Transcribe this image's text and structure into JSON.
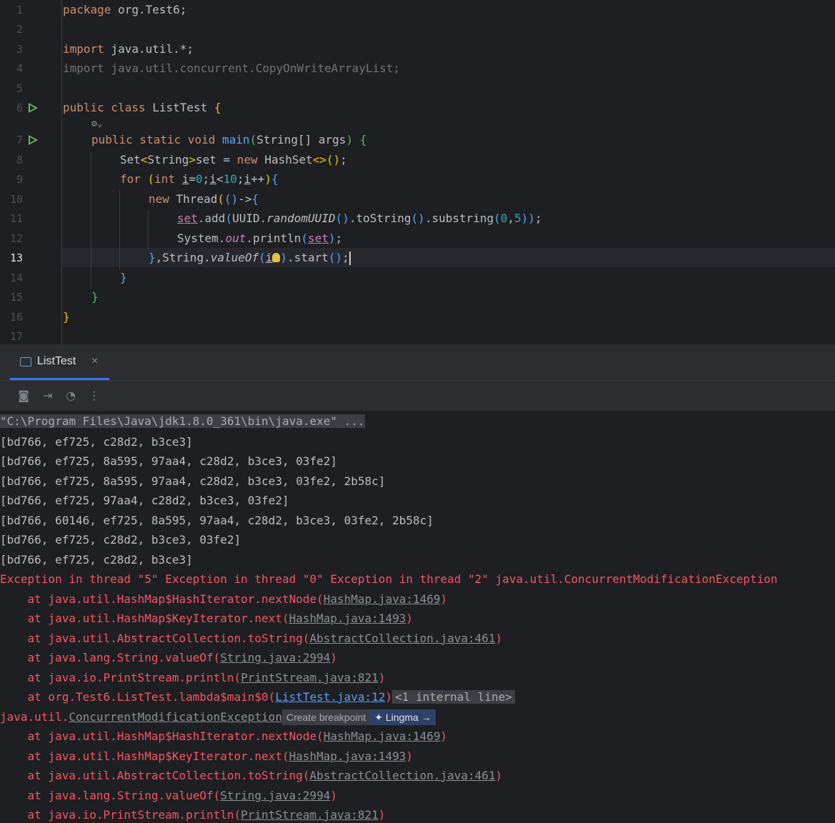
{
  "editor": {
    "line_numbers": [
      "1",
      "2",
      "3",
      "4",
      "5",
      "6",
      "7",
      "8",
      "9",
      "10",
      "11",
      "12",
      "13",
      "14",
      "15",
      "16",
      "17"
    ],
    "current_line": "13",
    "code": {
      "l1_kw": "package",
      "l1_rest": " org.Test6;",
      "l3_kw": "import",
      "l3_rest": " java.util.*;",
      "l4": "import java.util.concurrent.CopyOnWriteArrayList;",
      "l6_kw": "public class",
      "l6_name": " ListTest ",
      "l6_brace": "{",
      "l7_kw": "public static void",
      "l7_fn": " main",
      "l7_p1": "(",
      "l7_args": "String[] args",
      "l7_p2": ")",
      "l7_brace": " {",
      "l8_a": "Set",
      "l8_b": "<",
      "l8_c": "String",
      "l8_d": ">",
      "l8_e": "set = ",
      "l8_new": "new",
      "l8_f": " HashSet",
      "l8_g": "<>",
      "l8_h": "()",
      "l8_i": ";",
      "l9_kw": "for",
      "l9_p1": " (",
      "l9_int": "int",
      "l9_sp": " ",
      "l9_i1": "i",
      "l9_eq": "=",
      "l9_zero": "0",
      "l9_semi1": ";",
      "l9_i2": "i",
      "l9_lt": "<",
      "l9_ten": "10",
      "l9_semi2": ";",
      "l9_i3": "i",
      "l9_pp": "++",
      "l9_p2": ")",
      "l9_brace": "{",
      "l10_new": "new",
      "l10_a": " Thread",
      "l10_p1": "(",
      "l10_p2": "()",
      "l10_arrow": "->",
      "l10_brace": "{",
      "l11_set": "set",
      "l11_a": ".add",
      "l11_p1": "(",
      "l11_b": "UUID.",
      "l11_c": "randomUUID",
      "l11_p2": "()",
      "l11_d": ".toString",
      "l11_p3": "()",
      "l11_e": ".substring",
      "l11_p4": "(",
      "l11_n0": "0",
      "l11_comma": ",",
      "l11_n5": "5",
      "l11_p5": ")",
      "l11_p6": ")",
      "l11_semi": ";",
      "l12_a": "System.",
      "l12_out": "out",
      "l12_b": ".println",
      "l12_p1": "(",
      "l12_set": "set",
      "l12_p2": ")",
      "l12_semi": ";",
      "l13_brace": "}",
      "l13_a": ",String.",
      "l13_b": "valueOf",
      "l13_p1": "(",
      "l13_i": "i",
      "l13_p2": ")",
      "l13_c": ".start",
      "l13_p3": "()",
      "l13_semi": ";",
      "l14": "}",
      "l15": "}",
      "l16": "}"
    }
  },
  "run_panel": {
    "tab_label": "ListTest",
    "tab_close": "×",
    "toolbar_icons": [
      "camera-icon",
      "exit-icon",
      "profiler-icon",
      "more-icon"
    ],
    "command": "\"C:\\Program Files\\Java\\jdk1.8.0_361\\bin\\java.exe\" ...",
    "output": [
      "[bd766, ef725, c28d2, b3ce3]",
      "[bd766, ef725, 8a595, 97aa4, c28d2, b3ce3, 03fe2]",
      "[bd766, ef725, 8a595, 97aa4, c28d2, b3ce3, 03fe2, 2b58c]",
      "[bd766, ef725, 97aa4, c28d2, b3ce3, 03fe2]",
      "[bd766, 60146, ef725, 8a595, 97aa4, c28d2, b3ce3, 03fe2, 2b58c]",
      "[bd766, ef725, c28d2, b3ce3, 03fe2]",
      "[bd766, ef725, c28d2, b3ce3]"
    ],
    "exception_header": "Exception in thread \"5\" Exception in thread \"0\" Exception in thread \"2\" java.util.ConcurrentModificationException",
    "trace1": [
      {
        "prefix": "    at java.util.HashMap$HashIterator.nextNode(",
        "link": "HashMap.java:1469",
        "suffix": ")"
      },
      {
        "prefix": "    at java.util.HashMap$KeyIterator.next(",
        "link": "HashMap.java:1493",
        "suffix": ")"
      },
      {
        "prefix": "    at java.util.AbstractCollection.toString(",
        "link": "AbstractCollection.java:461",
        "suffix": ")"
      },
      {
        "prefix": "    at java.lang.String.valueOf(",
        "link": "String.java:2994",
        "suffix": ")"
      },
      {
        "prefix": "    at java.io.PrintStream.println(",
        "link": "PrintStream.java:821",
        "suffix": ")"
      }
    ],
    "trace_user": {
      "prefix": "    at org.Test6.ListTest.lambda$main$0(",
      "link": "ListTest.java:12",
      "suffix": ")",
      "internal": "<1 internal line>"
    },
    "exception2_prefix": "java.util.",
    "exception2_link": "ConcurrentModificationException",
    "create_breakpoint": "Create breakpoint",
    "lingma": "Lingma",
    "lingma_arrow": "→",
    "trace2": [
      {
        "prefix": "    at java.util.HashMap$HashIterator.nextNode(",
        "link": "HashMap.java:1469",
        "suffix": ")"
      },
      {
        "prefix": "    at java.util.HashMap$KeyIterator.next(",
        "link": "HashMap.java:1493",
        "suffix": ")"
      },
      {
        "prefix": "    at java.util.AbstractCollection.toString(",
        "link": "AbstractCollection.java:461",
        "suffix": ")"
      },
      {
        "prefix": "    at java.lang.String.valueOf(",
        "link": "String.java:2994",
        "suffix": ")"
      },
      {
        "prefix": "    at java.io.PrintStream.println(",
        "link": "PrintStream.java:821",
        "suffix": ")"
      }
    ]
  }
}
